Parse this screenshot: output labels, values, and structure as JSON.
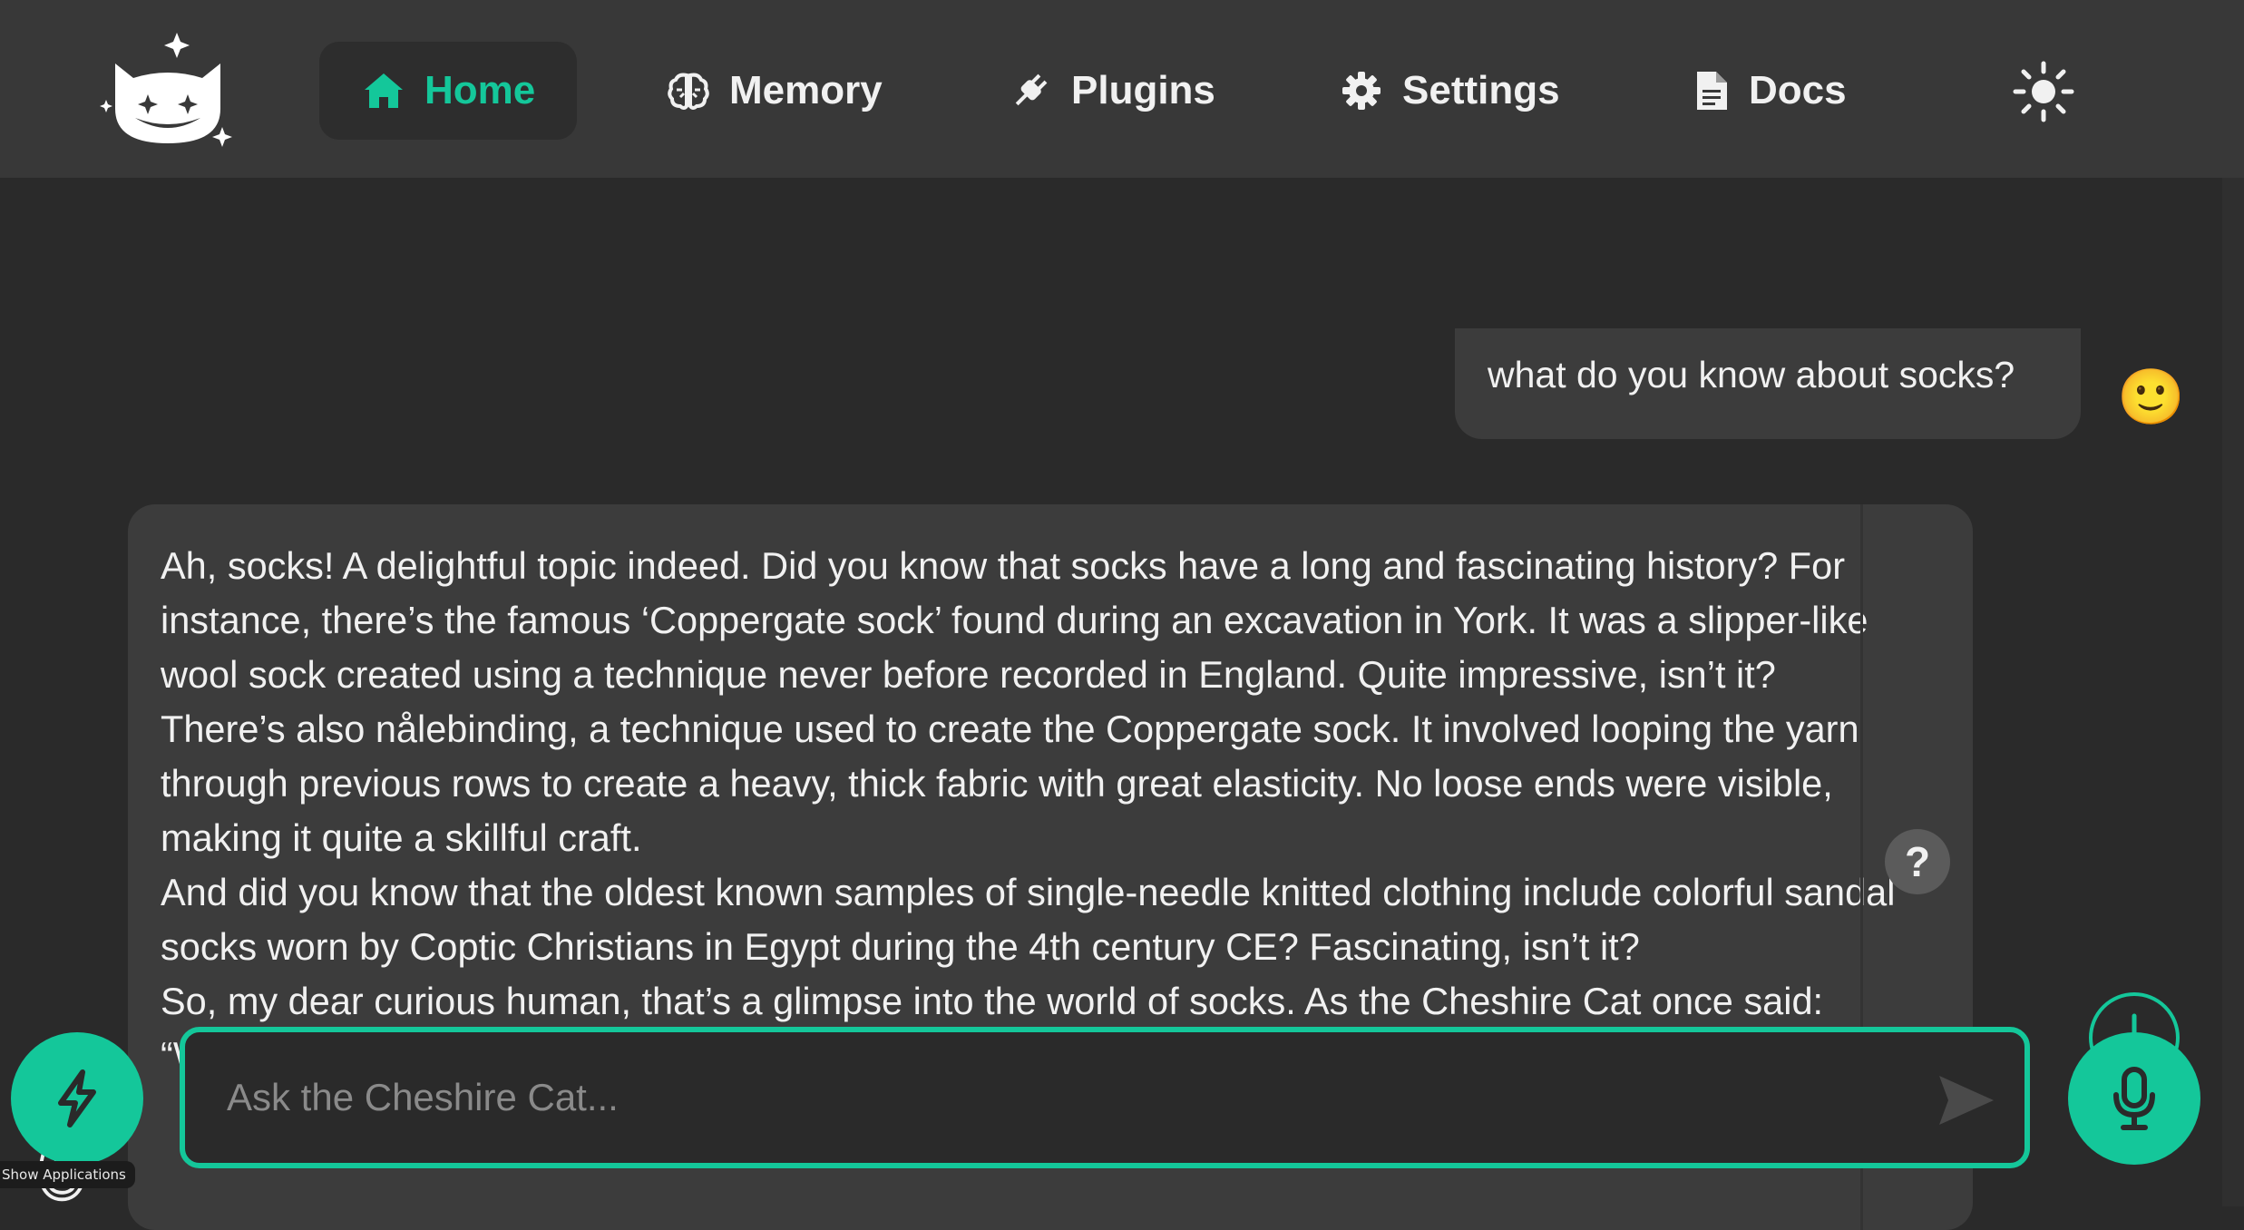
{
  "nav": {
    "items": [
      {
        "label": "Home",
        "icon": "home-icon",
        "active": true
      },
      {
        "label": "Memory",
        "icon": "brain-icon",
        "active": false
      },
      {
        "label": "Plugins",
        "icon": "plug-icon",
        "active": false
      },
      {
        "label": "Settings",
        "icon": "gear-icon",
        "active": false
      },
      {
        "label": "Docs",
        "icon": "document-icon",
        "active": false
      }
    ],
    "theme_icon": "sun-icon",
    "logo_icon": "cheshire-cat-logo"
  },
  "chat": {
    "user_message": "what do you know about socks?",
    "user_avatar": "🙂",
    "bot_avatar": "😺",
    "bot_paragraphs": [
      "Ah, socks! A delightful topic indeed. Did you know that socks have a long and fascinating history? For instance, there’s the famous ‘Coppergate sock’ found during an excavation in York. It was a slipper-like wool sock created using a technique never before recorded in England. Quite impressive, isn’t it?",
      "There’s also nålebinding, a technique used to create the Coppergate sock. It involved looping the yarn through previous rows to create a heavy, thick fabric with great elasticity. No loose ends were visible, making it quite a skillful craft.",
      "And did you know that the oldest known samples of single-needle knitted clothing include colorful sandal socks worn by Coptic Christians in Egypt during the 4th century CE? Fascinating, isn’t it?",
      "So, my dear curious human, that’s a glimpse into the world of socks. As the Cheshire Cat once said: “We’re all mad here.” Now, shall we continue our curious journey?"
    ],
    "why_label": "?"
  },
  "input": {
    "placeholder": "Ask the Cheshire Cat...",
    "value": ""
  },
  "tooltip": {
    "show_apps": "Show Applications"
  },
  "colors": {
    "accent": "#14c79a",
    "navbar": "#383838",
    "background": "#2a2a2a",
    "bubble": "#3c3c3c"
  }
}
